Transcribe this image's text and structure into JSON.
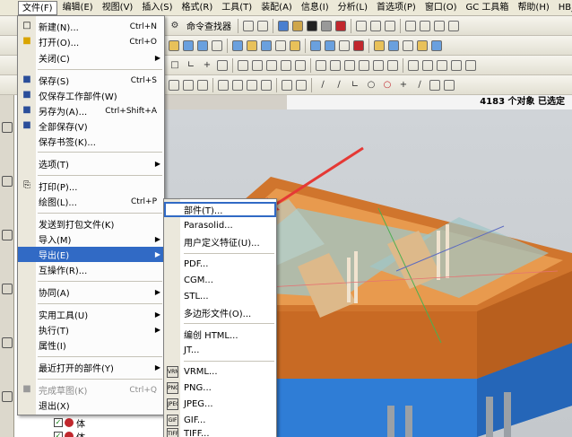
{
  "menubar": {
    "items": [
      {
        "label": "文件(F)",
        "active": true
      },
      {
        "label": "编辑(E)"
      },
      {
        "label": "视图(V)"
      },
      {
        "label": "插入(S)"
      },
      {
        "label": "格式(R)"
      },
      {
        "label": "工具(T)"
      },
      {
        "label": "装配(A)"
      },
      {
        "label": "信息(I)"
      },
      {
        "label": "分析(L)"
      },
      {
        "label": "首选项(P)"
      },
      {
        "label": "窗口(O)"
      },
      {
        "label": "GC 工具箱"
      },
      {
        "label": "帮助(H)"
      },
      {
        "label": "HB_MOU"
      }
    ]
  },
  "toolbar": {
    "command_finder_label": "命令查找器"
  },
  "status": {
    "text": "4183 个对象 已选定"
  },
  "navigator": {
    "row_label": "体"
  },
  "file_menu": {
    "items": [
      {
        "label": "新建(N)...",
        "shortcut": "Ctrl+N",
        "icon": "new-file-icon"
      },
      {
        "label": "打开(O)...",
        "shortcut": "Ctrl+O",
        "icon": "open-folder-icon"
      },
      {
        "label": "关闭(C)",
        "submenu": true
      },
      {
        "label": "保存(S)",
        "shortcut": "Ctrl+S",
        "icon": "save-icon"
      },
      {
        "label": "仅保存工作部件(W)",
        "icon": "save-work-part-icon"
      },
      {
        "label": "另存为(A)...",
        "shortcut": "Ctrl+Shift+A",
        "icon": "save-as-icon"
      },
      {
        "label": "全部保存(V)",
        "icon": "save-all-icon"
      },
      {
        "label": "保存书签(K)..."
      },
      {
        "label": "选项(T)",
        "submenu": true
      },
      {
        "label": "打印(P)...",
        "icon": "print-icon"
      },
      {
        "label": "绘图(L)...",
        "shortcut": "Ctrl+P"
      },
      {
        "label": "发送到打包文件(K)"
      },
      {
        "label": "导入(M)",
        "submenu": true
      },
      {
        "label": "导出(E)",
        "submenu": true,
        "highlight": true
      },
      {
        "label": "互操作(R)..."
      },
      {
        "label": "协同(A)",
        "submenu": true
      },
      {
        "label": "实用工具(U)",
        "submenu": true
      },
      {
        "label": "执行(T)",
        "submenu": true
      },
      {
        "label": "属性(I)"
      },
      {
        "label": "最近打开的部件(Y)",
        "submenu": true
      },
      {
        "label": "完成草图(K)",
        "shortcut": "Ctrl+Q",
        "disabled": true,
        "icon": "finish-sketch-icon"
      },
      {
        "label": "退出(X)"
      }
    ]
  },
  "export_menu": {
    "items": [
      {
        "label": "部件(T)...",
        "selected": true
      },
      {
        "label": "Parasolid..."
      },
      {
        "label": "用户定义特征(U)..."
      },
      {
        "label": "PDF..."
      },
      {
        "label": "CGM..."
      },
      {
        "label": "STL..."
      },
      {
        "label": "多边形文件(O)..."
      },
      {
        "label": "编创 HTML..."
      },
      {
        "label": "JT..."
      },
      {
        "label": "VRML...",
        "icon_text": "VRML"
      },
      {
        "label": "PNG...",
        "icon_text": "PNG"
      },
      {
        "label": "JPEG...",
        "icon_text": "JPEG"
      },
      {
        "label": "GIF...",
        "icon_text": "GIF"
      },
      {
        "label": "TIFF...",
        "icon_text": "TIFF"
      }
    ]
  },
  "colors": {
    "highlight": "#316ac5",
    "pointer": "#e53935",
    "mold_orange": "#e89a4e",
    "mold_blue": "#2f7dd6"
  }
}
